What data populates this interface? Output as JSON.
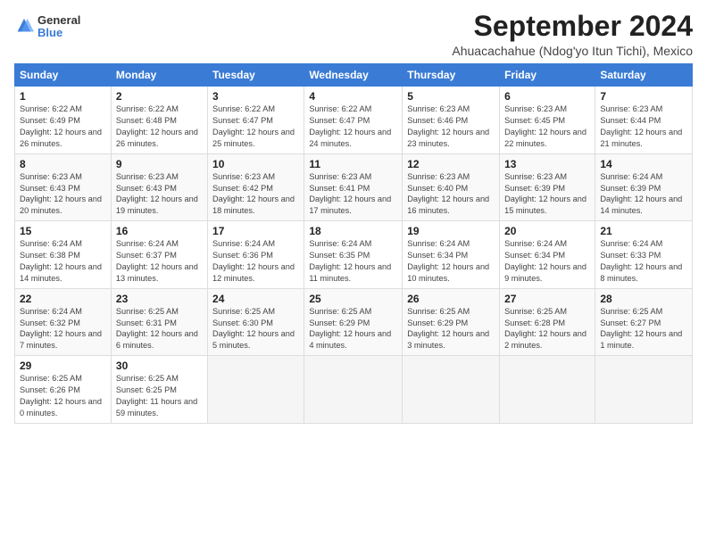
{
  "header": {
    "logo": {
      "general": "General",
      "blue": "Blue"
    },
    "title": "September 2024",
    "location": "Ahuacachahue (Ndog'yo Itun Tichi), Mexico"
  },
  "weekdays": [
    "Sunday",
    "Monday",
    "Tuesday",
    "Wednesday",
    "Thursday",
    "Friday",
    "Saturday"
  ],
  "weeks": [
    [
      {
        "day": "1",
        "sunrise": "Sunrise: 6:22 AM",
        "sunset": "Sunset: 6:49 PM",
        "daylight": "Daylight: 12 hours and 26 minutes."
      },
      {
        "day": "2",
        "sunrise": "Sunrise: 6:22 AM",
        "sunset": "Sunset: 6:48 PM",
        "daylight": "Daylight: 12 hours and 26 minutes."
      },
      {
        "day": "3",
        "sunrise": "Sunrise: 6:22 AM",
        "sunset": "Sunset: 6:47 PM",
        "daylight": "Daylight: 12 hours and 25 minutes."
      },
      {
        "day": "4",
        "sunrise": "Sunrise: 6:22 AM",
        "sunset": "Sunset: 6:47 PM",
        "daylight": "Daylight: 12 hours and 24 minutes."
      },
      {
        "day": "5",
        "sunrise": "Sunrise: 6:23 AM",
        "sunset": "Sunset: 6:46 PM",
        "daylight": "Daylight: 12 hours and 23 minutes."
      },
      {
        "day": "6",
        "sunrise": "Sunrise: 6:23 AM",
        "sunset": "Sunset: 6:45 PM",
        "daylight": "Daylight: 12 hours and 22 minutes."
      },
      {
        "day": "7",
        "sunrise": "Sunrise: 6:23 AM",
        "sunset": "Sunset: 6:44 PM",
        "daylight": "Daylight: 12 hours and 21 minutes."
      }
    ],
    [
      {
        "day": "8",
        "sunrise": "Sunrise: 6:23 AM",
        "sunset": "Sunset: 6:43 PM",
        "daylight": "Daylight: 12 hours and 20 minutes."
      },
      {
        "day": "9",
        "sunrise": "Sunrise: 6:23 AM",
        "sunset": "Sunset: 6:43 PM",
        "daylight": "Daylight: 12 hours and 19 minutes."
      },
      {
        "day": "10",
        "sunrise": "Sunrise: 6:23 AM",
        "sunset": "Sunset: 6:42 PM",
        "daylight": "Daylight: 12 hours and 18 minutes."
      },
      {
        "day": "11",
        "sunrise": "Sunrise: 6:23 AM",
        "sunset": "Sunset: 6:41 PM",
        "daylight": "Daylight: 12 hours and 17 minutes."
      },
      {
        "day": "12",
        "sunrise": "Sunrise: 6:23 AM",
        "sunset": "Sunset: 6:40 PM",
        "daylight": "Daylight: 12 hours and 16 minutes."
      },
      {
        "day": "13",
        "sunrise": "Sunrise: 6:23 AM",
        "sunset": "Sunset: 6:39 PM",
        "daylight": "Daylight: 12 hours and 15 minutes."
      },
      {
        "day": "14",
        "sunrise": "Sunrise: 6:24 AM",
        "sunset": "Sunset: 6:39 PM",
        "daylight": "Daylight: 12 hours and 14 minutes."
      }
    ],
    [
      {
        "day": "15",
        "sunrise": "Sunrise: 6:24 AM",
        "sunset": "Sunset: 6:38 PM",
        "daylight": "Daylight: 12 hours and 14 minutes."
      },
      {
        "day": "16",
        "sunrise": "Sunrise: 6:24 AM",
        "sunset": "Sunset: 6:37 PM",
        "daylight": "Daylight: 12 hours and 13 minutes."
      },
      {
        "day": "17",
        "sunrise": "Sunrise: 6:24 AM",
        "sunset": "Sunset: 6:36 PM",
        "daylight": "Daylight: 12 hours and 12 minutes."
      },
      {
        "day": "18",
        "sunrise": "Sunrise: 6:24 AM",
        "sunset": "Sunset: 6:35 PM",
        "daylight": "Daylight: 12 hours and 11 minutes."
      },
      {
        "day": "19",
        "sunrise": "Sunrise: 6:24 AM",
        "sunset": "Sunset: 6:34 PM",
        "daylight": "Daylight: 12 hours and 10 minutes."
      },
      {
        "day": "20",
        "sunrise": "Sunrise: 6:24 AM",
        "sunset": "Sunset: 6:34 PM",
        "daylight": "Daylight: 12 hours and 9 minutes."
      },
      {
        "day": "21",
        "sunrise": "Sunrise: 6:24 AM",
        "sunset": "Sunset: 6:33 PM",
        "daylight": "Daylight: 12 hours and 8 minutes."
      }
    ],
    [
      {
        "day": "22",
        "sunrise": "Sunrise: 6:24 AM",
        "sunset": "Sunset: 6:32 PM",
        "daylight": "Daylight: 12 hours and 7 minutes."
      },
      {
        "day": "23",
        "sunrise": "Sunrise: 6:25 AM",
        "sunset": "Sunset: 6:31 PM",
        "daylight": "Daylight: 12 hours and 6 minutes."
      },
      {
        "day": "24",
        "sunrise": "Sunrise: 6:25 AM",
        "sunset": "Sunset: 6:30 PM",
        "daylight": "Daylight: 12 hours and 5 minutes."
      },
      {
        "day": "25",
        "sunrise": "Sunrise: 6:25 AM",
        "sunset": "Sunset: 6:29 PM",
        "daylight": "Daylight: 12 hours and 4 minutes."
      },
      {
        "day": "26",
        "sunrise": "Sunrise: 6:25 AM",
        "sunset": "Sunset: 6:29 PM",
        "daylight": "Daylight: 12 hours and 3 minutes."
      },
      {
        "day": "27",
        "sunrise": "Sunrise: 6:25 AM",
        "sunset": "Sunset: 6:28 PM",
        "daylight": "Daylight: 12 hours and 2 minutes."
      },
      {
        "day": "28",
        "sunrise": "Sunrise: 6:25 AM",
        "sunset": "Sunset: 6:27 PM",
        "daylight": "Daylight: 12 hours and 1 minute."
      }
    ],
    [
      {
        "day": "29",
        "sunrise": "Sunrise: 6:25 AM",
        "sunset": "Sunset: 6:26 PM",
        "daylight": "Daylight: 12 hours and 0 minutes."
      },
      {
        "day": "30",
        "sunrise": "Sunrise: 6:25 AM",
        "sunset": "Sunset: 6:25 PM",
        "daylight": "Daylight: 11 hours and 59 minutes."
      },
      {
        "day": "",
        "sunrise": "",
        "sunset": "",
        "daylight": ""
      },
      {
        "day": "",
        "sunrise": "",
        "sunset": "",
        "daylight": ""
      },
      {
        "day": "",
        "sunrise": "",
        "sunset": "",
        "daylight": ""
      },
      {
        "day": "",
        "sunrise": "",
        "sunset": "",
        "daylight": ""
      },
      {
        "day": "",
        "sunrise": "",
        "sunset": "",
        "daylight": ""
      }
    ]
  ]
}
